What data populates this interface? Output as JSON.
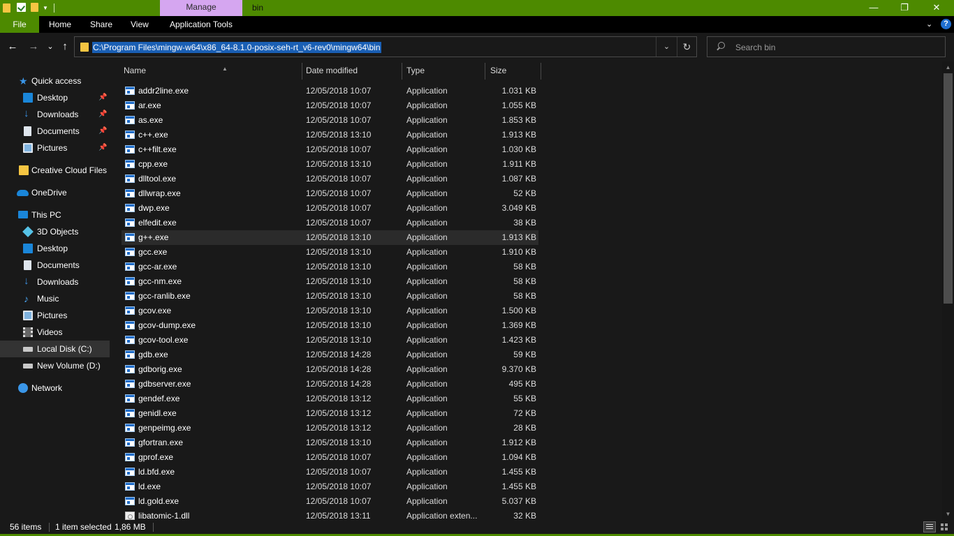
{
  "window": {
    "title": "bin",
    "manage_tab": "Manage",
    "controls": {
      "minimize": "—",
      "maximize": "❐",
      "close": "✕"
    }
  },
  "ribbon": {
    "tabs": [
      "File",
      "Home",
      "Share",
      "View",
      "Application Tools"
    ],
    "collapse_glyph": "⌄",
    "help_glyph": "?"
  },
  "nav": {
    "back": "←",
    "forward": "→",
    "recent": "⌄",
    "up": "↑"
  },
  "address": {
    "path": "C:\\Program Files\\mingw-w64\\x86_64-8.1.0-posix-seh-rt_v6-rev0\\mingw64\\bin",
    "dropdown_glyph": "⌄",
    "refresh_glyph": "↻"
  },
  "search": {
    "placeholder": "Search bin"
  },
  "sidebar": {
    "items": [
      {
        "label": "Quick access",
        "icon": "star-icon",
        "level": 0,
        "pinned": false
      },
      {
        "label": "Desktop",
        "icon": "desktop-icon",
        "level": 1,
        "pinned": true
      },
      {
        "label": "Downloads",
        "icon": "downloads-icon",
        "level": 1,
        "pinned": true
      },
      {
        "label": "Documents",
        "icon": "documents-icon",
        "level": 1,
        "pinned": true
      },
      {
        "label": "Pictures",
        "icon": "pictures-icon",
        "level": 1,
        "pinned": true
      },
      {
        "label": "Creative Cloud Files",
        "icon": "folder-icon",
        "level": 0,
        "pinned": false
      },
      {
        "label": "OneDrive",
        "icon": "onedrive-icon",
        "level": 0,
        "pinned": false
      },
      {
        "label": "This PC",
        "icon": "this-pc-icon",
        "level": 0,
        "pinned": false
      },
      {
        "label": "3D Objects",
        "icon": "3d-objects-icon",
        "level": 1,
        "pinned": false
      },
      {
        "label": "Desktop",
        "icon": "desktop-icon",
        "level": 1,
        "pinned": false
      },
      {
        "label": "Documents",
        "icon": "documents-icon",
        "level": 1,
        "pinned": false
      },
      {
        "label": "Downloads",
        "icon": "downloads-icon",
        "level": 1,
        "pinned": false
      },
      {
        "label": "Music",
        "icon": "music-icon",
        "level": 1,
        "pinned": false
      },
      {
        "label": "Pictures",
        "icon": "pictures-icon",
        "level": 1,
        "pinned": false
      },
      {
        "label": "Videos",
        "icon": "videos-icon",
        "level": 1,
        "pinned": false
      },
      {
        "label": "Local Disk (C:)",
        "icon": "local-disk-icon",
        "level": 1,
        "pinned": false,
        "selected": true
      },
      {
        "label": "New Volume (D:)",
        "icon": "drive-icon",
        "level": 1,
        "pinned": false
      },
      {
        "label": "Network",
        "icon": "network-icon",
        "level": 0,
        "pinned": false
      }
    ]
  },
  "columns": {
    "name": "Name",
    "date": "Date modified",
    "type": "Type",
    "size": "Size"
  },
  "files": [
    {
      "name": "addr2line.exe",
      "date": "12/05/2018 10:07",
      "type": "Application",
      "size": "1.031 KB"
    },
    {
      "name": "ar.exe",
      "date": "12/05/2018 10:07",
      "type": "Application",
      "size": "1.055 KB"
    },
    {
      "name": "as.exe",
      "date": "12/05/2018 10:07",
      "type": "Application",
      "size": "1.853 KB"
    },
    {
      "name": "c++.exe",
      "date": "12/05/2018 13:10",
      "type": "Application",
      "size": "1.913 KB"
    },
    {
      "name": "c++filt.exe",
      "date": "12/05/2018 10:07",
      "type": "Application",
      "size": "1.030 KB"
    },
    {
      "name": "cpp.exe",
      "date": "12/05/2018 13:10",
      "type": "Application",
      "size": "1.911 KB"
    },
    {
      "name": "dlltool.exe",
      "date": "12/05/2018 10:07",
      "type": "Application",
      "size": "1.087 KB"
    },
    {
      "name": "dllwrap.exe",
      "date": "12/05/2018 10:07",
      "type": "Application",
      "size": "52 KB"
    },
    {
      "name": "dwp.exe",
      "date": "12/05/2018 10:07",
      "type": "Application",
      "size": "3.049 KB"
    },
    {
      "name": "elfedit.exe",
      "date": "12/05/2018 10:07",
      "type": "Application",
      "size": "38 KB"
    },
    {
      "name": "g++.exe",
      "date": "12/05/2018 13:10",
      "type": "Application",
      "size": "1.913 KB",
      "selected": true
    },
    {
      "name": "gcc.exe",
      "date": "12/05/2018 13:10",
      "type": "Application",
      "size": "1.910 KB"
    },
    {
      "name": "gcc-ar.exe",
      "date": "12/05/2018 13:10",
      "type": "Application",
      "size": "58 KB"
    },
    {
      "name": "gcc-nm.exe",
      "date": "12/05/2018 13:10",
      "type": "Application",
      "size": "58 KB"
    },
    {
      "name": "gcc-ranlib.exe",
      "date": "12/05/2018 13:10",
      "type": "Application",
      "size": "58 KB"
    },
    {
      "name": "gcov.exe",
      "date": "12/05/2018 13:10",
      "type": "Application",
      "size": "1.500 KB"
    },
    {
      "name": "gcov-dump.exe",
      "date": "12/05/2018 13:10",
      "type": "Application",
      "size": "1.369 KB"
    },
    {
      "name": "gcov-tool.exe",
      "date": "12/05/2018 13:10",
      "type": "Application",
      "size": "1.423 KB"
    },
    {
      "name": "gdb.exe",
      "date": "12/05/2018 14:28",
      "type": "Application",
      "size": "59 KB"
    },
    {
      "name": "gdborig.exe",
      "date": "12/05/2018 14:28",
      "type": "Application",
      "size": "9.370 KB"
    },
    {
      "name": "gdbserver.exe",
      "date": "12/05/2018 14:28",
      "type": "Application",
      "size": "495 KB"
    },
    {
      "name": "gendef.exe",
      "date": "12/05/2018 13:12",
      "type": "Application",
      "size": "55 KB"
    },
    {
      "name": "genidl.exe",
      "date": "12/05/2018 13:12",
      "type": "Application",
      "size": "72 KB"
    },
    {
      "name": "genpeimg.exe",
      "date": "12/05/2018 13:12",
      "type": "Application",
      "size": "28 KB"
    },
    {
      "name": "gfortran.exe",
      "date": "12/05/2018 13:10",
      "type": "Application",
      "size": "1.912 KB"
    },
    {
      "name": "gprof.exe",
      "date": "12/05/2018 10:07",
      "type": "Application",
      "size": "1.094 KB"
    },
    {
      "name": "ld.bfd.exe",
      "date": "12/05/2018 10:07",
      "type": "Application",
      "size": "1.455 KB"
    },
    {
      "name": "ld.exe",
      "date": "12/05/2018 10:07",
      "type": "Application",
      "size": "1.455 KB"
    },
    {
      "name": "ld.gold.exe",
      "date": "12/05/2018 10:07",
      "type": "Application",
      "size": "5.037 KB"
    },
    {
      "name": "libatomic-1.dll",
      "date": "12/05/2018 13:11",
      "type": "Application exten...",
      "size": "32 KB"
    }
  ],
  "status": {
    "item_count": "56 items",
    "selection": "1 item selected",
    "selection_size": "1,86 MB"
  },
  "colors": {
    "accent_green": "#4d8a00",
    "manage_purple": "#d5a6f0",
    "selection_blue": "#1a5fb4",
    "background": "#191919"
  }
}
